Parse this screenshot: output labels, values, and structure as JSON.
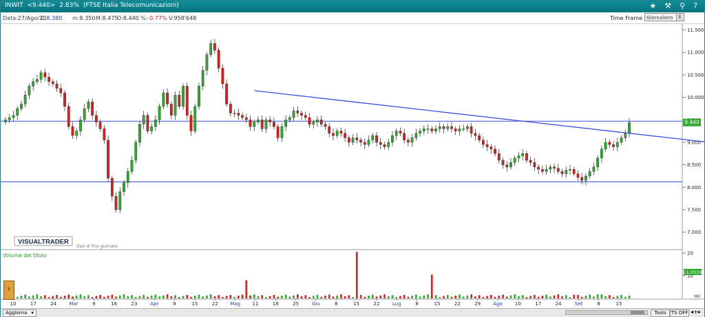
{
  "titlebar": {
    "symbol": "INWIT",
    "price": "<9.440>",
    "change": "2.83%",
    "sector": "(FTSE Italia Telecomunicazioni)",
    "icons": [
      "star-icon",
      "hammer-icon",
      "pin-icon",
      "help-icon"
    ]
  },
  "infobar": {
    "date_label": "Data:",
    "date_value": "27/Ago/20",
    "close_label": "C:",
    "close_value": "8.380",
    "min_label": "m:",
    "min_value": "8.350",
    "max_label": "M:",
    "max_value": "8.475",
    "open_label": "O:",
    "open_value": "8.440",
    "pct_label": "%:",
    "pct_value": "-0.77%",
    "vol_label": "V:",
    "vol_value": "958'648",
    "timeframe_label": "Time Frame",
    "timeframe_value": "Giornaliero"
  },
  "chart_data": {
    "type": "candlestick",
    "current_price_label": "9.440",
    "price_axis_ticks": [
      "11.500",
      "11.000",
      "10.500",
      "10.000",
      "9.500",
      "9.000",
      "8.500",
      "8.000",
      "7.500",
      "7.000"
    ],
    "ylim": [
      6.75,
      11.6
    ],
    "x_tick_labels": [
      "10",
      "17",
      "24",
      "Mar",
      "9",
      "16",
      "23",
      "Apr",
      "8",
      "15",
      "22",
      "Mag",
      "11",
      "18",
      "25",
      "Giu",
      "8",
      "15",
      "22",
      "Lug",
      "8",
      "15",
      "22",
      "29",
      "Ago",
      "10",
      "17",
      "24",
      "Set",
      "8",
      "15"
    ],
    "month_labels": [
      "Mar",
      "Apr",
      "Mag",
      "Giu",
      "Lug",
      "Ago",
      "Set"
    ],
    "horizontal_lines": [
      9.47,
      8.12
    ],
    "trendline": {
      "from": {
        "i": 63,
        "v": 10.15
      },
      "to": {
        "i": 190,
        "v": 8.82
      }
    },
    "branding": "VISUALTRADER",
    "branding_sub": "Dati di fine giornata",
    "volume_title": "Volume del titolo",
    "volume_axis_ticks": [
      "20",
      "10"
    ],
    "volume_value_label": "11,0519",
    "volume_unit": "Mil",
    "colors": {
      "up": "#2fa82f",
      "down": "#d42020",
      "line": "#3a4ed8"
    },
    "candles_close": [
      9.5,
      9.55,
      9.6,
      9.75,
      9.85,
      10.05,
      10.25,
      10.35,
      10.4,
      10.55,
      10.45,
      10.35,
      10.3,
      10.2,
      10.1,
      9.8,
      9.35,
      9.15,
      9.25,
      9.5,
      9.75,
      9.9,
      9.6,
      9.45,
      9.3,
      9.05,
      8.2,
      7.8,
      7.5,
      7.9,
      8.1,
      8.35,
      8.6,
      9.0,
      9.4,
      9.6,
      9.25,
      9.35,
      9.5,
      9.8,
      10.1,
      9.85,
      9.6,
      10.05,
      9.8,
      10.25,
      9.6,
      9.25,
      9.8,
      10.25,
      10.6,
      10.95,
      11.2,
      11.05,
      10.65,
      10.3,
      9.85,
      9.65,
      9.65,
      9.6,
      9.55,
      9.5,
      9.35,
      9.45,
      9.5,
      9.3,
      9.5,
      9.45,
      9.35,
      9.1,
      9.35,
      9.5,
      9.55,
      9.7,
      9.65,
      9.6,
      9.55,
      9.4,
      9.45,
      9.5,
      9.4,
      9.35,
      9.2,
      9.15,
      9.25,
      9.2,
      9.1,
      9.0,
      9.1,
      9.05,
      9.0,
      8.95,
      9.05,
      9.15,
      9.0,
      8.95,
      8.9,
      9.0,
      9.15,
      9.25,
      9.2,
      9.05,
      9.0,
      9.1,
      9.2,
      9.25,
      9.3,
      9.3,
      9.25,
      9.3,
      9.35,
      9.3,
      9.35,
      9.3,
      9.25,
      9.3,
      9.3,
      9.35,
      9.2,
      9.15,
      9.05,
      8.95,
      8.9,
      8.85,
      8.75,
      8.6,
      8.5,
      8.45,
      8.55,
      8.65,
      8.7,
      8.75,
      8.6,
      8.55,
      8.45,
      8.4,
      8.35,
      8.4,
      8.45,
      8.42,
      8.35,
      8.3,
      8.38,
      8.4,
      8.3,
      8.22,
      8.15,
      8.25,
      8.35,
      8.45,
      8.65,
      8.85,
      9.0,
      8.95,
      8.9,
      9.0,
      9.1,
      9.2,
      9.44
    ]
  }
}
